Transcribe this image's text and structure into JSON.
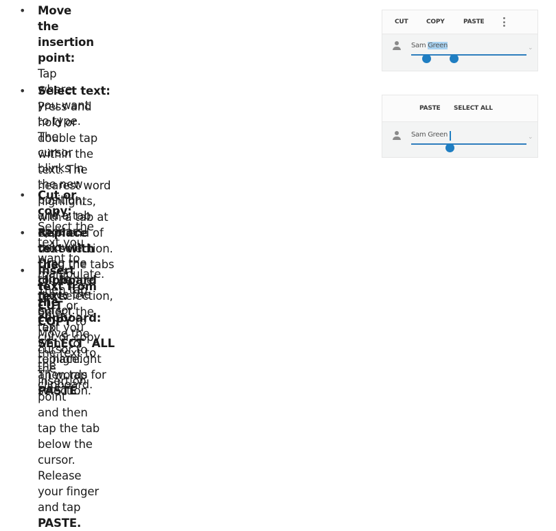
{
  "items": [
    {
      "bullet": "•",
      "bold": "Move the insertion point:",
      "lines": [
        " Tap where you want",
        "to type. The cursor blinks in the new position,",
        "and a tab appears below it. Drag the tab to",
        "move the cursor."
      ]
    },
    {
      "bullet": "•",
      "bold": "Select text:",
      "lines": [
        " Press and hold or double tap",
        "within the text. The nearest word highlights,",
        "with a tab at each end of the selection.",
        "Drag  the tabs to change the selection, or",
        "tap ",
        "SELECT  ALL",
        " to highlight all words for",
        "selection."
      ]
    },
    {
      "bullet": "•",
      "bold": "Cut or copy:",
      "parts": [
        " Select the text you want to manipulate. Then tap ",
        "CUT",
        " or",
        "COPY",
        " to cut or copy the text to the clipboard."
      ]
    },
    {
      "bullet": "•",
      "bold": "Replace text with the clipboard text:",
      "parts": [
        " Select the text you want to",
        "replace. Then tap ",
        "PASTE",
        "."
      ]
    },
    {
      "bullet": "•",
      "bold": "Insert text from the clipboard:",
      "parts": [
        " Move the cursor to the insertion point",
        "and then tap the tab below the cursor. Release your finger and tap ",
        "PASTE."
      ]
    }
  ],
  "screenshot1": {
    "toolbar": [
      "CUT",
      "COPY",
      "PASTE"
    ],
    "field_plain": "Sam ",
    "field_selected": "Green"
  },
  "screenshot2": {
    "toolbar": [
      "PASTE",
      "SELECT ALL"
    ],
    "field_text": "Sam Green"
  },
  "colors": {
    "accent": "#1f7ec2",
    "selection": "#a9d3f2"
  }
}
